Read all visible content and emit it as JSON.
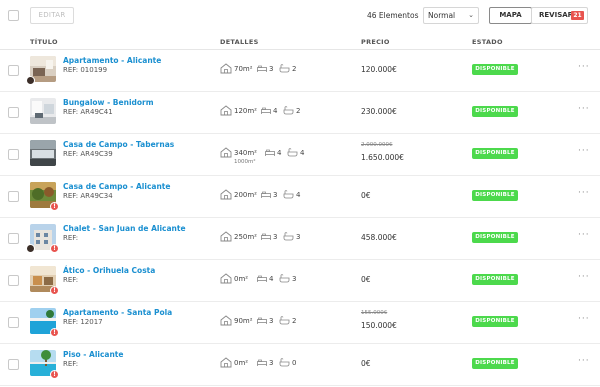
{
  "toolbar": {
    "editar_label": "EDITAR",
    "count_label": "46 Elementos",
    "sort_select": {
      "value": "Normal"
    },
    "mapa_label": "MAPA",
    "revisar_label": "REVISAR",
    "revisar_badge": "21"
  },
  "columns": {
    "titulo": "TÍTULO",
    "detalles": "DETALLES",
    "precio": "PRECIO",
    "estado": "ESTADO"
  },
  "colors": {
    "link": "#1a8fd0",
    "status_green": "#4cd94c",
    "warn_red": "#e8544f"
  },
  "listings": [
    {
      "title": "Apartamento - Alicante",
      "ref": "REF: 010199",
      "area": "70m²",
      "beds": "3",
      "baths": "2",
      "price": "120.000€",
      "status": "DISPONIBLE",
      "avatar": true,
      "warn": false,
      "thumb": "interior-living"
    },
    {
      "title": "Bungalow - Benidorm",
      "ref": "REF: AR49C41",
      "area": "120m²",
      "beds": "4",
      "baths": "2",
      "price": "230.000€",
      "status": "DISPONIBLE",
      "avatar": false,
      "warn": false,
      "thumb": "interior-white"
    },
    {
      "title": "Casa de Campo - Tabernas",
      "ref": "REF: AR49C39",
      "area": "340m²",
      "area2": "1000m²",
      "beds": "4",
      "baths": "4",
      "price_old": "2.000.000€",
      "price": "1.650.000€",
      "status": "DISPONIBLE",
      "avatar": false,
      "warn": false,
      "thumb": "interior-dark"
    },
    {
      "title": "Casa de Campo - Alicante",
      "ref": "REF: AR49C34",
      "area": "200m²",
      "beds": "3",
      "baths": "4",
      "price": "0€",
      "status": "DISPONIBLE",
      "avatar": false,
      "warn": true,
      "thumb": "garden"
    },
    {
      "title": "Chalet - San Juan de Alicante",
      "ref": "REF:",
      "area": "250m²",
      "beds": "3",
      "baths": "3",
      "price": "458.000€",
      "status": "DISPONIBLE",
      "avatar": true,
      "warn": true,
      "thumb": "building"
    },
    {
      "title": "Ático - Orihuela Costa",
      "ref": "REF:",
      "area": "0m²",
      "beds": "4",
      "baths": "3",
      "price": "0€",
      "status": "DISPONIBLE",
      "avatar": false,
      "warn": true,
      "thumb": "interior-warm"
    },
    {
      "title": "Apartamento - Santa Pola",
      "ref": "REF: 12017",
      "area": "90m²",
      "beds": "3",
      "baths": "2",
      "price_old": "155.000€",
      "price": "150.000€",
      "status": "DISPONIBLE",
      "avatar": false,
      "warn": true,
      "thumb": "pool"
    },
    {
      "title": "Piso - Alicante",
      "ref": "REF:",
      "area": "0m²",
      "beds": "3",
      "baths": "0",
      "price": "0€",
      "status": "DISPONIBLE",
      "avatar": false,
      "warn": true,
      "thumb": "pool-palm"
    }
  ]
}
